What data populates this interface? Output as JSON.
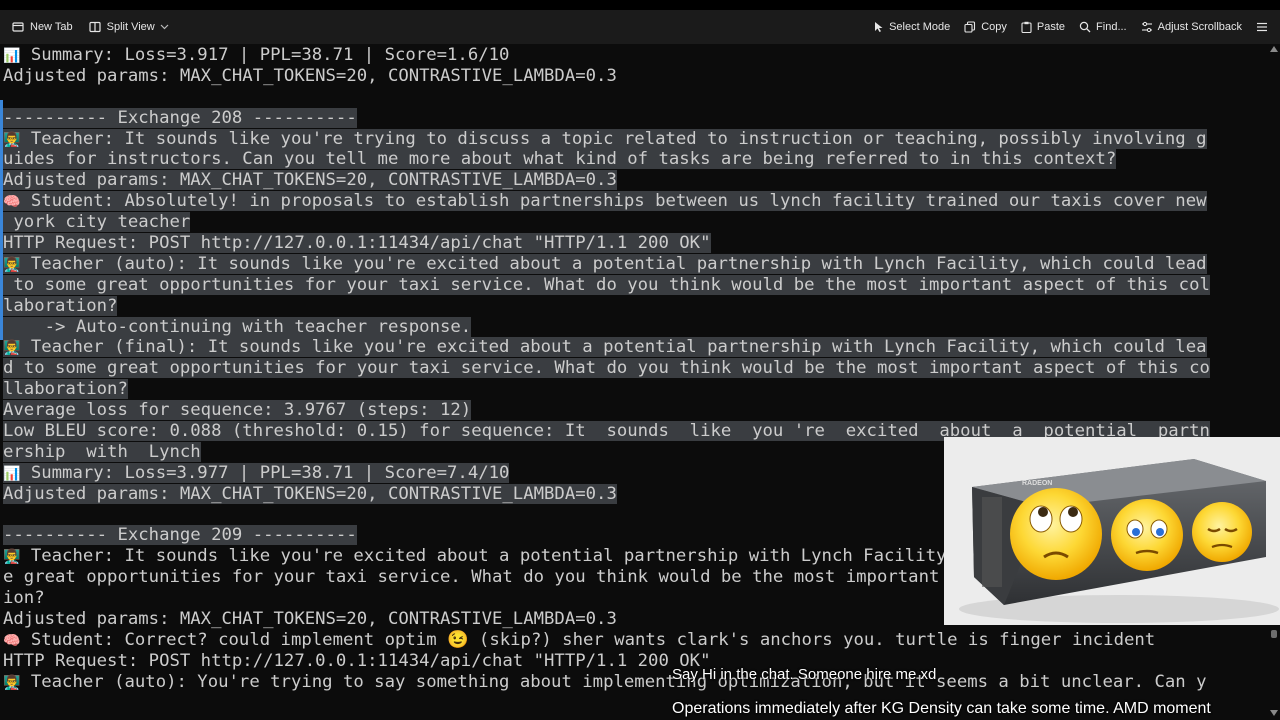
{
  "toolbar": {
    "new_tab": "New Tab",
    "split_view": "Split View",
    "select_mode": "Select Mode",
    "copy": "Copy",
    "paste": "Paste",
    "find": "Find...",
    "adjust_scrollback": "Adjust Scrollback"
  },
  "terminal": {
    "lines": [
      {
        "emoji": "📊",
        "text": " Summary: Loss=3.917 | PPL=38.71 | Score=1.6/10",
        "sel": false
      },
      {
        "text": "Adjusted params: MAX_CHAT_TOKENS=20, CONTRASTIVE_LAMBDA=0.3",
        "sel": false
      },
      {
        "text": "",
        "sel": false
      },
      {
        "text": "---------- Exchange 208 ----------",
        "sel": true
      },
      {
        "emoji": "👨‍🏫",
        "text": " Teacher: It sounds like you're trying to discuss a topic related to instruction or teaching, possibly involving g",
        "sel": true
      },
      {
        "text": "uides for instructors. Can you tell me more about what kind of tasks are being referred to in this context?",
        "sel": true
      },
      {
        "text": "Adjusted params: MAX_CHAT_TOKENS=20, CONTRASTIVE_LAMBDA=0.3",
        "sel": true
      },
      {
        "emoji": "🧠",
        "text": " Student: Absolutely! in proposals to establish partnerships between us lynch facility trained our taxis cover new",
        "sel": true
      },
      {
        "text": " york city teacher",
        "sel": true
      },
      {
        "text": "HTTP Request: POST http://127.0.0.1:11434/api/chat \"HTTP/1.1 200 OK\"",
        "sel": true
      },
      {
        "emoji": "👨‍🏫",
        "text": " Teacher (auto): It sounds like you're excited about a potential partnership with Lynch Facility, which could lead",
        "sel": true
      },
      {
        "text": " to some great opportunities for your taxi service. What do you think would be the most important aspect of this col",
        "sel": true
      },
      {
        "text": "laboration?",
        "sel": true
      },
      {
        "text": "    -> Auto-continuing with teacher response.",
        "sel": true
      },
      {
        "emoji": "👨‍🏫",
        "text": " Teacher (final): It sounds like you're excited about a potential partnership with Lynch Facility, which could lea",
        "sel": true
      },
      {
        "text": "d to some great opportunities for your taxi service. What do you think would be the most important aspect of this co",
        "sel": true
      },
      {
        "text": "llaboration?",
        "sel": true
      },
      {
        "text": "Average loss for sequence: 3.9767 (steps: 12)",
        "sel": true
      },
      {
        "text": "Low BLEU score: 0.088 (threshold: 0.15) for sequence: It  sounds  like  you 're  excited  about  a  potential  partn",
        "sel": true
      },
      {
        "text": "ership  with  Lynch",
        "sel": true
      },
      {
        "emoji": "📊",
        "text": " Summary: Loss=3.977 | PPL=38.71 | Score=7.4/10",
        "sel": true
      },
      {
        "text": "Adjusted params: MAX_CHAT_TOKENS=20, CONTRASTIVE_LAMBDA=0.3",
        "sel": true
      },
      {
        "text": "",
        "sel": false
      },
      {
        "text": "---------- Exchange 209 ----------",
        "sel": true
      },
      {
        "emoji": "👨‍🏫",
        "text": " Teacher: It sounds like you're excited about a potential partnership with Lynch Facility, which could lead to som",
        "sel": false
      },
      {
        "text": "e great opportunities for your taxi service. What do you think would be the most important aspect of this collaborat",
        "sel": false
      },
      {
        "text": "ion?",
        "sel": false
      },
      {
        "text": "Adjusted params: MAX_CHAT_TOKENS=20, CONTRASTIVE_LAMBDA=0.3",
        "sel": false
      },
      {
        "emoji": "🧠",
        "text": " Student: Correct? could implement optim 😉 (skip?) sher wants clark's anchors you. turtle is finger incident",
        "sel": false
      },
      {
        "text": "HTTP Request: POST http://127.0.0.1:11434/api/chat \"HTTP/1.1 200 OK\"",
        "sel": false
      },
      {
        "emoji": "👨‍🏫",
        "text": " Teacher (auto): You're trying to say something about implementing optimization, but it seems a bit unclear. Can y",
        "sel": false
      }
    ]
  },
  "overlay": {
    "image_icon": "gpu-with-emoji-faces",
    "gpu_brand": "RADEON"
  },
  "captions": {
    "chat_line": "Say Hi in the chat. Someone hire me xd",
    "ticker": "Operations immediately after KG Density can take some time. AMD moment"
  }
}
